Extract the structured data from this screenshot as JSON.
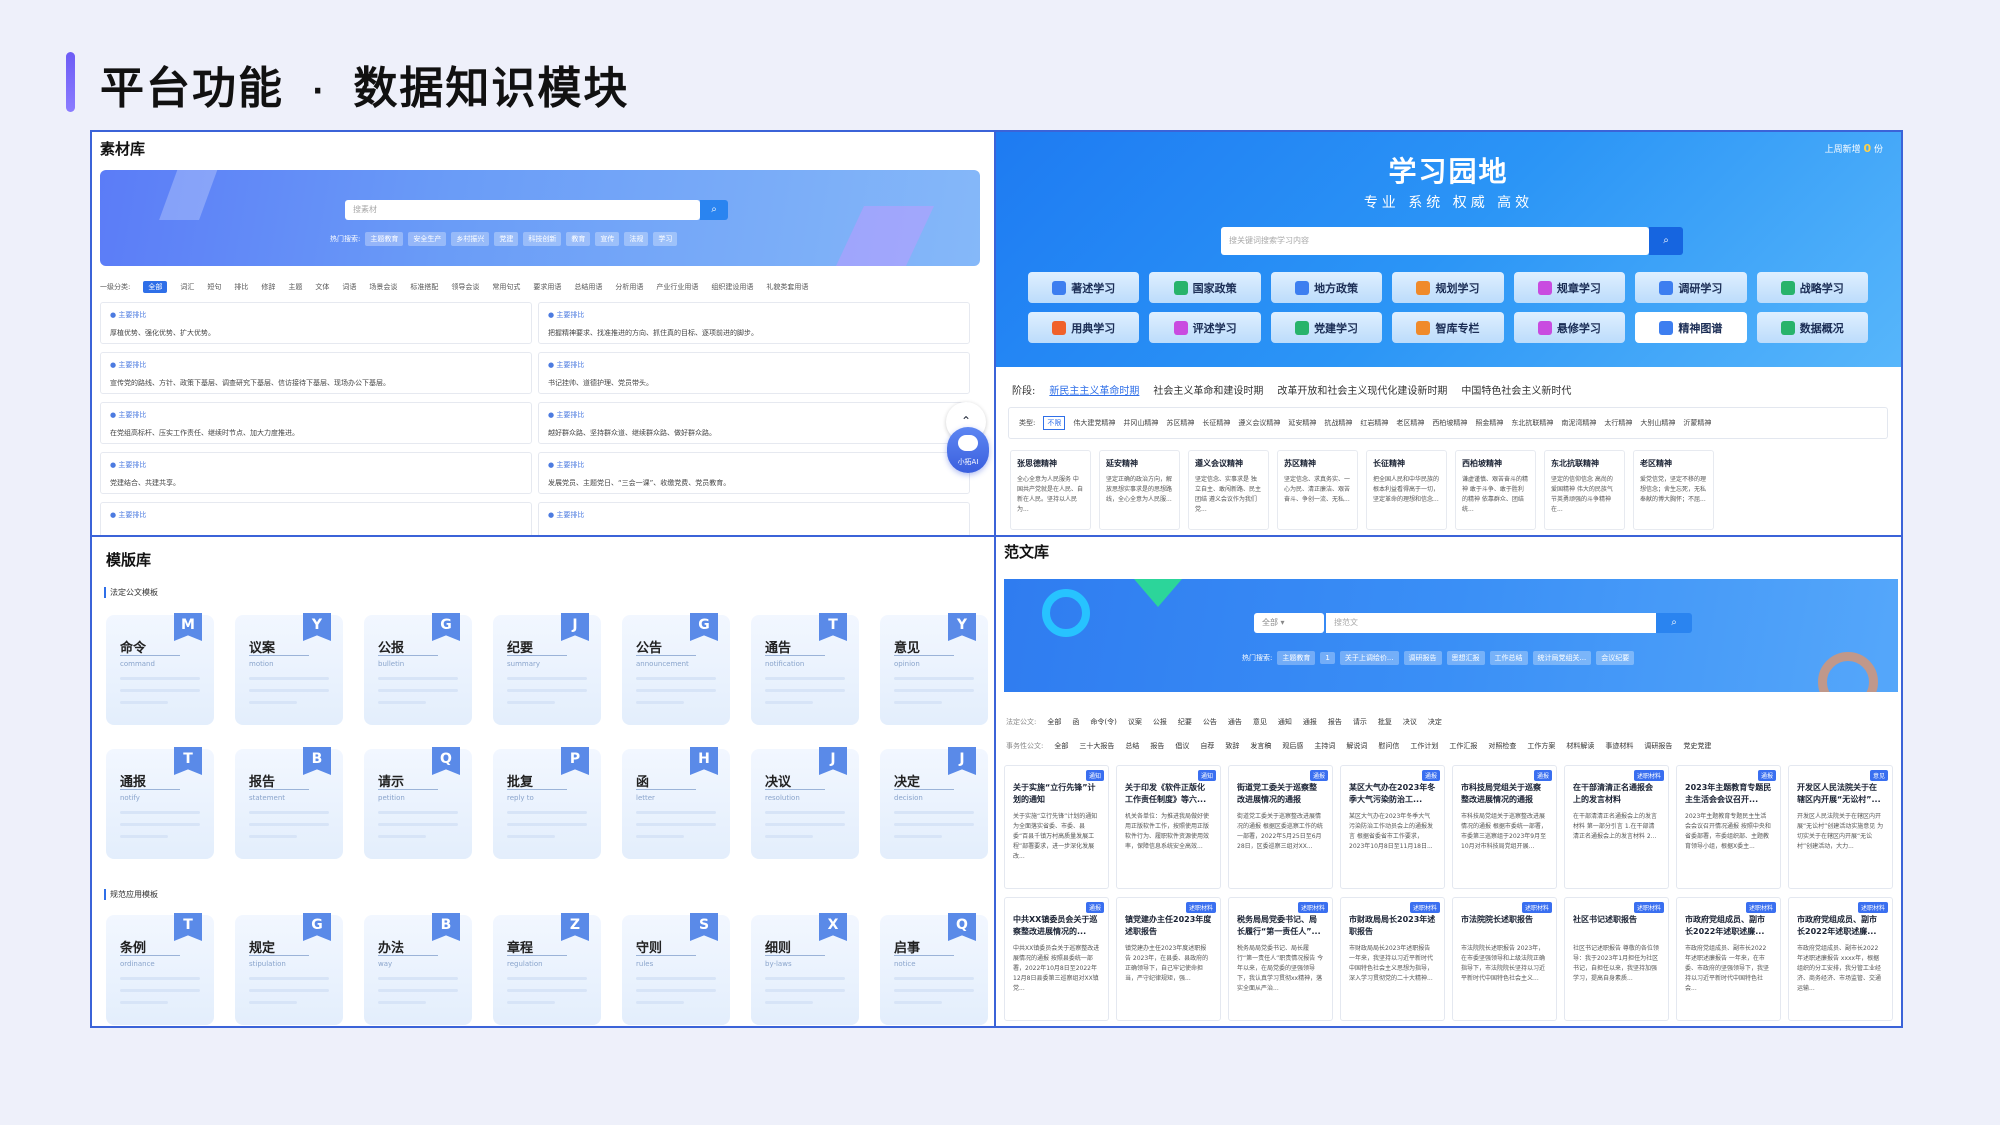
{
  "page": {
    "title": "平台功能",
    "separator": "·",
    "subtitle": "数据知识模块"
  },
  "materials": {
    "title": "素材库",
    "search_placeholder": "搜素材",
    "hot_label": "热门搜索:",
    "hot_tags": [
      "主题教育",
      "安全生产",
      "乡村振兴",
      "党建",
      "科技创新",
      "教育",
      "宣传",
      "法规",
      "学习"
    ],
    "category_label": "一级分类:",
    "categories": [
      "全部",
      "词汇",
      "短句",
      "排比",
      "修辞",
      "主题",
      "文体",
      "词语",
      "场景会谈",
      "标准搭配",
      "领导会谈",
      "常用句式",
      "要求用语",
      "总结用语",
      "分析用语",
      "产业行业用语",
      "组织建设用语",
      "礼貌类套用语"
    ],
    "items": [
      {
        "tag": "主要排比",
        "text": "厚植优势、强化优势、扩大优势。"
      },
      {
        "tag": "主要排比",
        "text": "把握精神要求、找准推进的方向、抓住真的目标、逐项前进的脚步。"
      },
      {
        "tag": "主要排比",
        "text": "宣传党的路线、方针、政策下基层、调查研究下基层、信访接待下基层、现场办公下基层。"
      },
      {
        "tag": "主要排比",
        "text": "书记挂帅、道德护理、党员带头。"
      },
      {
        "tag": "主要排比",
        "text": "在党组高标杆、压实工作责任、继续时节点、加大力度推进。"
      },
      {
        "tag": "主要排比",
        "text": "越好群众路、坚持群众道、继续群众路、做好群众路。"
      },
      {
        "tag": "主要排比",
        "text": "党建结合、共建共享。"
      },
      {
        "tag": "主要排比",
        "text": "发展党员、主题党日、“三会一课”、收缴党费、党员教育。"
      },
      {
        "tag": "主要排比",
        "text": ""
      },
      {
        "tag": "主要排比",
        "text": ""
      }
    ],
    "ai_label": "小拓AI"
  },
  "study": {
    "title": "学习园地",
    "subtitle": "专业 系统 权威 高效",
    "new_label": "上周新增",
    "new_count": "0",
    "new_unit": "份",
    "search_placeholder": "搜关键词搜索学习内容",
    "buttons": [
      {
        "label": "著述学习",
        "color": "#3d7ef0"
      },
      {
        "label": "国家政策",
        "color": "#27b36b"
      },
      {
        "label": "地方政策",
        "color": "#3d7ef0"
      },
      {
        "label": "规划学习",
        "color": "#f08a2a"
      },
      {
        "label": "规章学习",
        "color": "#c94be0"
      },
      {
        "label": "调研学习",
        "color": "#3d7ef0"
      },
      {
        "label": "战略学习",
        "color": "#27b36b"
      },
      {
        "label": "用典学习",
        "color": "#f0612a"
      },
      {
        "label": "评述学习",
        "color": "#c94be0"
      },
      {
        "label": "党建学习",
        "color": "#27b36b"
      },
      {
        "label": "智库专栏",
        "color": "#f08a2a"
      },
      {
        "label": "悬修学习",
        "color": "#c94be0"
      },
      {
        "label": "精神图谱",
        "color": "#3d7ef0"
      },
      {
        "label": "数据概况",
        "color": "#27b36b"
      }
    ],
    "stage_label": "阶段:",
    "stages": [
      "新民主主义革命时期",
      "社会主义革命和建设时期",
      "改革开放和社会主义现代化建设新时期",
      "中国特色社会主义新时代"
    ],
    "type_label": "类型:",
    "types": [
      "不限",
      "伟大建党精神",
      "井冈山精神",
      "苏区精神",
      "长征精神",
      "遵义会议精神",
      "延安精神",
      "抗战精神",
      "红岩精神",
      "老区精神",
      "西柏坡精神",
      "照金精神",
      "东北抗联精神",
      "南泥湾精神",
      "太行精神",
      "大别山精神",
      "沂蒙精神"
    ],
    "spirits": [
      {
        "title": "张思德精神",
        "text": "全心全意为人民服务 中国共产党就是在人民、自新在人民。坚持以人民为..."
      },
      {
        "title": "延安精神",
        "text": "坚定正确的政治方向，解放思想实事求是的思想路线，全心全意为人民服..."
      },
      {
        "title": "遵义会议精神",
        "text": "坚定信念、实事求是 独立自主、敢闯新路、民主团结 遵义会议作为我们党..."
      },
      {
        "title": "苏区精神",
        "text": "坚定信念、求真务实、一心为民、清正廉洁、艰苦奋斗、争创一流、无私..."
      },
      {
        "title": "长征精神",
        "text": "把全国人民和中华民族的根本利益看得高于一切，坚定革命的理想和信念..."
      },
      {
        "title": "西柏坡精神",
        "text": "谦虚谨慎、艰苦奋斗的精神 敢于斗争、敢于胜利的精神 依靠群众、团结统..."
      },
      {
        "title": "东北抗联精神",
        "text": "坚定的信仰信念 高尚的爱国精神 伟大的民族气节英勇顽强的斗争精神 在..."
      },
      {
        "title": "老区精神",
        "text": "爱党信党，坚定不移的理想信念；舍生忘死，无私奉献的博大胸怀；不屈..."
      }
    ]
  },
  "templates": {
    "title": "模版库",
    "section1": "法定公文模板",
    "section2": "规范应用模板",
    "row1": [
      {
        "cn": "命令",
        "en": "command",
        "letter": "M"
      },
      {
        "cn": "议案",
        "en": "motion",
        "letter": "Y"
      },
      {
        "cn": "公报",
        "en": "bulletin",
        "letter": "G"
      },
      {
        "cn": "纪要",
        "en": "summary",
        "letter": "J"
      },
      {
        "cn": "公告",
        "en": "announcement",
        "letter": "G"
      },
      {
        "cn": "通告",
        "en": "notification",
        "letter": "T"
      },
      {
        "cn": "意见",
        "en": "opinion",
        "letter": "Y"
      }
    ],
    "row2": [
      {
        "cn": "通报",
        "en": "notify",
        "letter": "T"
      },
      {
        "cn": "报告",
        "en": "statement",
        "letter": "B"
      },
      {
        "cn": "请示",
        "en": "petition",
        "letter": "Q"
      },
      {
        "cn": "批复",
        "en": "reply to",
        "letter": "P"
      },
      {
        "cn": "函",
        "en": "letter",
        "letter": "H"
      },
      {
        "cn": "决议",
        "en": "resolution",
        "letter": "J"
      },
      {
        "cn": "决定",
        "en": "decision",
        "letter": "J"
      }
    ],
    "row3": [
      {
        "cn": "条例",
        "en": "ordinance",
        "letter": "T"
      },
      {
        "cn": "规定",
        "en": "stipulation",
        "letter": "G"
      },
      {
        "cn": "办法",
        "en": "way",
        "letter": "B"
      },
      {
        "cn": "章程",
        "en": "regulation",
        "letter": "Z"
      },
      {
        "cn": "守则",
        "en": "rules",
        "letter": "S"
      },
      {
        "cn": "细则",
        "en": "by-laws",
        "letter": "X"
      },
      {
        "cn": "启事",
        "en": "notice",
        "letter": "Q"
      }
    ]
  },
  "samples": {
    "title": "范文库",
    "select_value": "全部",
    "search_placeholder": "搜范文",
    "hot_label": "热门搜索:",
    "hot_tags": [
      "主题教育",
      "1",
      "关于上调绘价...",
      "调研报告",
      "思想汇报",
      "工作总结",
      "统计局党组关...",
      "会议纪要"
    ],
    "legal_label": "法定公文:",
    "legal": [
      "全部",
      "函",
      "命令(令)",
      "议案",
      "公报",
      "纪要",
      "公告",
      "通告",
      "意见",
      "通知",
      "通报",
      "报告",
      "请示",
      "批复",
      "决议",
      "决定"
    ],
    "affairs_label": "事务性公文:",
    "affairs": [
      "全部",
      "三十大报告",
      "总结",
      "报告",
      "倡议",
      "自荐",
      "致辞",
      "发言稿",
      "观后感",
      "主持词",
      "解说词",
      "慰问信",
      "工作计划",
      "工作汇报",
      "对照检查",
      "工作方案",
      "材料解读",
      "事迹材料",
      "调研报告",
      "党史党建"
    ],
    "articles": [
      {
        "badge": "通知",
        "title": "关于实施“立行先锋”计划的通知",
        "text": "关于实施“立行先锋”计划的通知 为全面落实省委、市委、县委“百县千镇万村高质量发展工程”部署要求，进一步深化发展改..."
      },
      {
        "badge": "通知",
        "title": "关于印发《软件正版化工作责任制度》等六...",
        "text": "机关各单位：为推进我局做好使用正版软件工作，按照使用正版软件行为、履职软件资源使用效率，保障信息系统安全高效..."
      },
      {
        "badge": "通报",
        "title": "街道党工委关于巡察整改进展情况的通报",
        "text": "街道党工委关于巡察整改进展情况的通报 根据区委巡察工作的统一部署，2022年5月25日至6月28日，区委巡察三组对XX..."
      },
      {
        "badge": "通报",
        "title": "某区大气办在2023年冬季大气污染防治工...",
        "text": "某区大气办在2023年冬季大气污染防治工作动员会上的通报发言 根据省委省市工作要求，2023年10月8日至11月18日..."
      },
      {
        "badge": "通报",
        "title": "市科技局党组关于巡察整改进展情况的通报",
        "text": "市科技局党组关于巡察整改进展情况的通报 根据市委统一部署，市委第三巡察组于2023年9月至10月对市科技局党组开展..."
      },
      {
        "badge": "述职材料",
        "title": "在干部清清正名通报会上的发言材料",
        "text": "在干部清清正名通报会上的发言材料 第一部分引言 1.在干部清清正名通报会上的发言材料 2..."
      },
      {
        "badge": "通报",
        "title": "2023年主题教育专题民主生活会会议召开...",
        "text": "2023年主题教育专题民主生活会会议召开情况通报 按照中央和省委部署，市委组织部、主题教育领导小组，根据X委主..."
      },
      {
        "badge": "意见",
        "title": "开发区人民法院关于在辖区内开展“无讼村”...",
        "text": "开发区人民法院关于在辖区内开展“无讼村”创建活动实施意见 为切实关于在辖区内开展“无讼村”创建活动，大力..."
      },
      {
        "badge": "通报",
        "title": "中共XX镇委员会关于巡察整改进展情况的...",
        "text": "中共XX镇委员会关于巡察整改进展情况的通报 按照县委统一部署，2022年10月8日至2022年12月8日县委第三巡察组对XX镇党..."
      },
      {
        "badge": "述职材料",
        "title": "镇党建办主任2023年度述职报告",
        "text": "镇党建办主任2023年度述职报告 2023年，在县委、县政府的正确领导下，自己牢记使命担当，严守纪律规矩，强..."
      },
      {
        "badge": "述职材料",
        "title": "税务局局党委书记、局长履行“第一责任人”...",
        "text": "税务局局党委书记、局长履行“第一责任人”职责情况报告 今年以来，在局党委的坚强领导下，我认真学习贯彻xx精神，落实全面从严治..."
      },
      {
        "badge": "述职材料",
        "title": "市财政局局长2023年述职报告",
        "text": "市财政局局长2023年述职报告 一年来，我坚持以习近平新时代中国特色社会主义思想为指导，深入学习贯彻党的二十大精神..."
      },
      {
        "badge": "述职材料",
        "title": "市法院院长述职报告",
        "text": "市法院院长述职报告 2023年，在市委坚强领导和上级法院正确指导下，市法院院长坚持以习近平新时代中国特色社会主义..."
      },
      {
        "badge": "述职材料",
        "title": "社区书记述职报告",
        "text": "社区书记述职报告 尊敬的各位领导：我于2023年1月担任为社区书记，自担任以来，我坚持加强学习，提高自身素质..."
      },
      {
        "badge": "述职材料",
        "title": "市政府党组成员、副市长2022年述职述廉...",
        "text": "市政府党组成员、副市长2022年述职述廉报告 一年来，在市委、市政府的坚强领导下，我坚持以习近平新时代中国特色社会..."
      },
      {
        "badge": "述职材料",
        "title": "市政府党组成员、副市长2022年述职述廉...",
        "text": "市政府党组成员、副市长2022年述职述廉报告 xxxx年，根据组织的分工安排，我分管工业经济、商务经济、市场监管、交通运输..."
      }
    ]
  }
}
